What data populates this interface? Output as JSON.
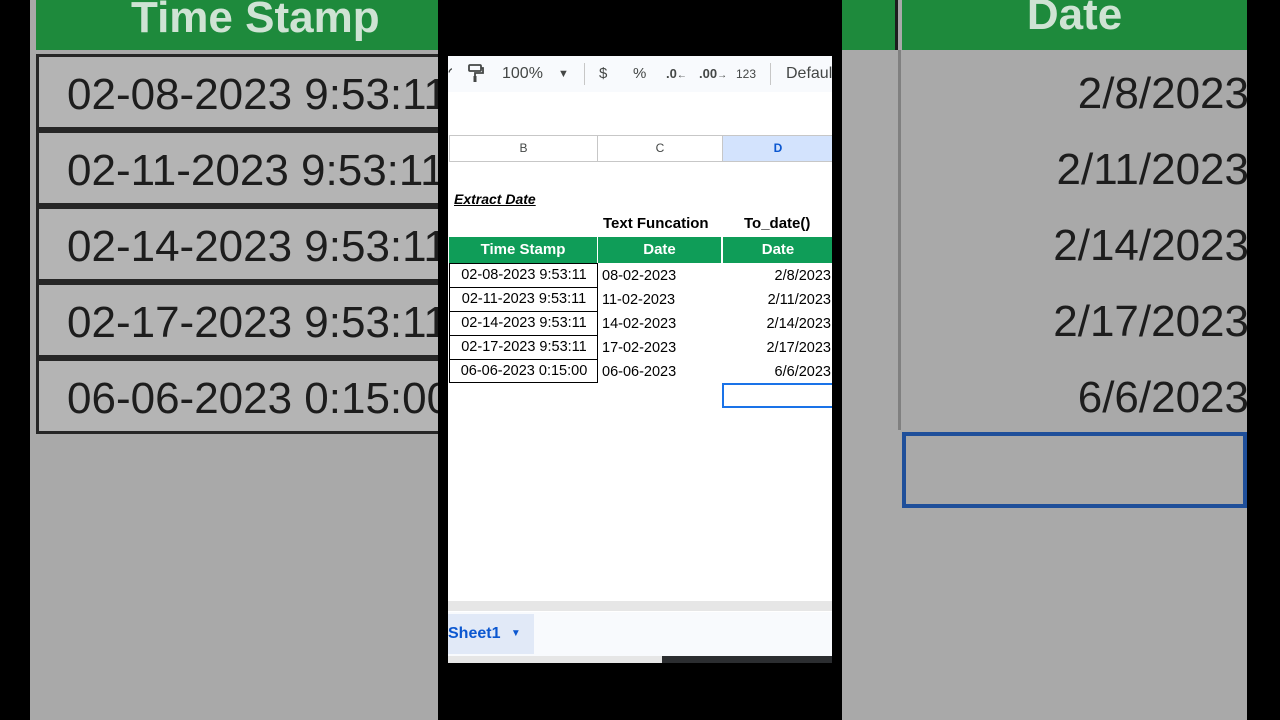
{
  "background_left": {
    "header": "Time Stamp",
    "rows": [
      "02-08-2023 9:53:11",
      "02-11-2023 9:53:11",
      "02-14-2023 9:53:11",
      "02-17-2023 9:53:11",
      "06-06-2023 0:15:00"
    ]
  },
  "background_right": {
    "header": "Date",
    "values": [
      "2/8/2023",
      "2/11/2023",
      "2/14/2023",
      "2/17/2023",
      "6/6/2023"
    ]
  },
  "toolbar": {
    "zoom": "100%",
    "currency": "$",
    "percent": "%",
    "decrease_decimal": ".0",
    "increase_decimal": ".00",
    "number_format": "123",
    "font": "Defaul"
  },
  "columns": [
    "B",
    "C",
    "D"
  ],
  "sheet": {
    "title": "Extract Date",
    "subheaders": [
      "Text Funcation",
      "To_date()"
    ],
    "headers": [
      "Time Stamp",
      "Date",
      "Date"
    ],
    "rows": [
      {
        "timestamp": "02-08-2023 9:53:11",
        "text_date": "08-02-2023",
        "to_date": "2/8/2023"
      },
      {
        "timestamp": "02-11-2023 9:53:11",
        "text_date": "11-02-2023",
        "to_date": "2/11/2023"
      },
      {
        "timestamp": "02-14-2023 9:53:11",
        "text_date": "14-02-2023",
        "to_date": "2/14/2023"
      },
      {
        "timestamp": "02-17-2023 9:53:11",
        "text_date": "17-02-2023",
        "to_date": "2/17/2023"
      },
      {
        "timestamp": "06-06-2023 0:15:00",
        "text_date": "06-06-2023",
        "to_date": "6/6/2023"
      }
    ]
  },
  "sheet_tab": "Sheet1",
  "colors": {
    "header_green": "#0f9d58",
    "selection_blue": "#1a73e8",
    "sheet_tab_blue": "#0b57d0"
  }
}
